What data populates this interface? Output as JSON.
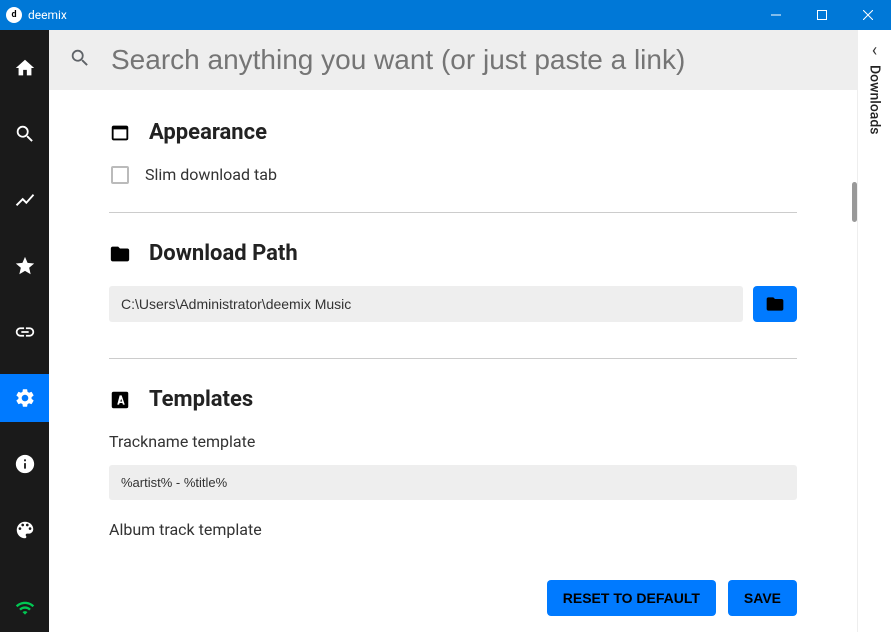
{
  "window": {
    "title": "deemix"
  },
  "search": {
    "placeholder": "Search anything you want (or just paste a link)"
  },
  "downloadsTab": {
    "label": "Downloads"
  },
  "sections": {
    "appearance": {
      "title": "Appearance",
      "slimTabLabel": "Slim download tab"
    },
    "downloadPath": {
      "title": "Download Path",
      "value": "C:\\Users\\Administrator\\deemix Music"
    },
    "templates": {
      "title": "Templates",
      "tracknameLabel": "Trackname template",
      "tracknameValue": "%artist% - %title%",
      "albumLabel": "Album track template"
    }
  },
  "buttons": {
    "reset": "RESET TO DEFAULT",
    "save": "SAVE"
  }
}
